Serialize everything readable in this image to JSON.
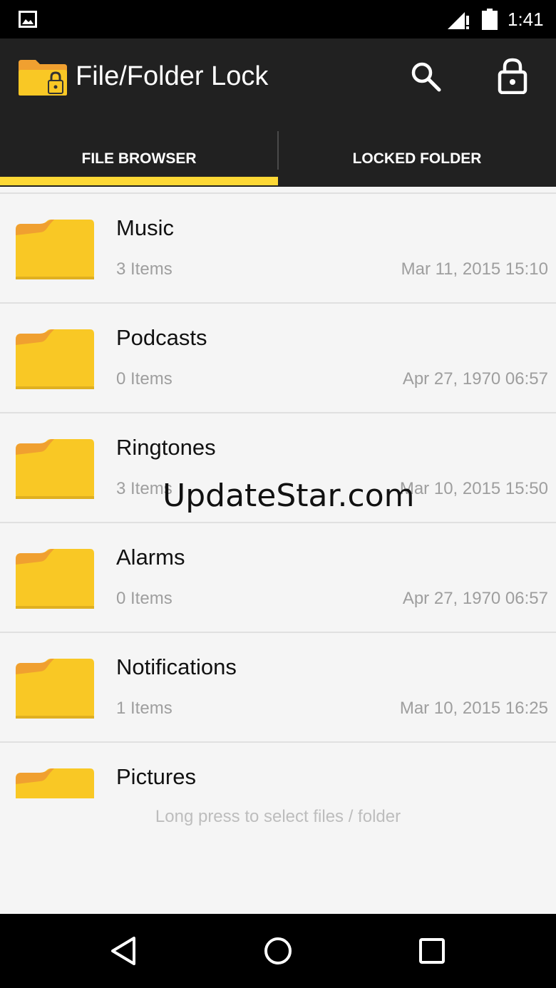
{
  "status_bar": {
    "time": "1:41",
    "icons": [
      "image-notification-icon",
      "signal-icon",
      "battery-icon"
    ]
  },
  "app_bar": {
    "title": "File/Folder Lock",
    "actions": [
      "search-icon",
      "lock-icon"
    ]
  },
  "tabs": [
    {
      "label": "FILE BROWSER",
      "selected": true
    },
    {
      "label": "LOCKED FOLDER",
      "selected": false
    }
  ],
  "folders": [
    {
      "name": "Music",
      "count": "3 Items",
      "date": "Mar 11, 2015 15:10"
    },
    {
      "name": "Podcasts",
      "count": "0 Items",
      "date": "Apr 27, 1970 06:57"
    },
    {
      "name": "Ringtones",
      "count": "3 Items",
      "date": "Mar 10, 2015 15:50"
    },
    {
      "name": "Alarms",
      "count": "0 Items",
      "date": "Apr 27, 1970 06:57"
    },
    {
      "name": "Notifications",
      "count": "1 Items",
      "date": "Mar 10, 2015 16:25"
    },
    {
      "name": "Pictures",
      "count": "",
      "date": ""
    }
  ],
  "hint": "Long press to select files / folder",
  "watermark": "UpdateStar.com",
  "nav_bar": [
    "back-icon",
    "home-icon",
    "recents-icon"
  ],
  "colors": {
    "accent": "#fdd835",
    "app_bar": "#212121",
    "folder": "#f9c825",
    "folder_tab": "#f0a030"
  }
}
